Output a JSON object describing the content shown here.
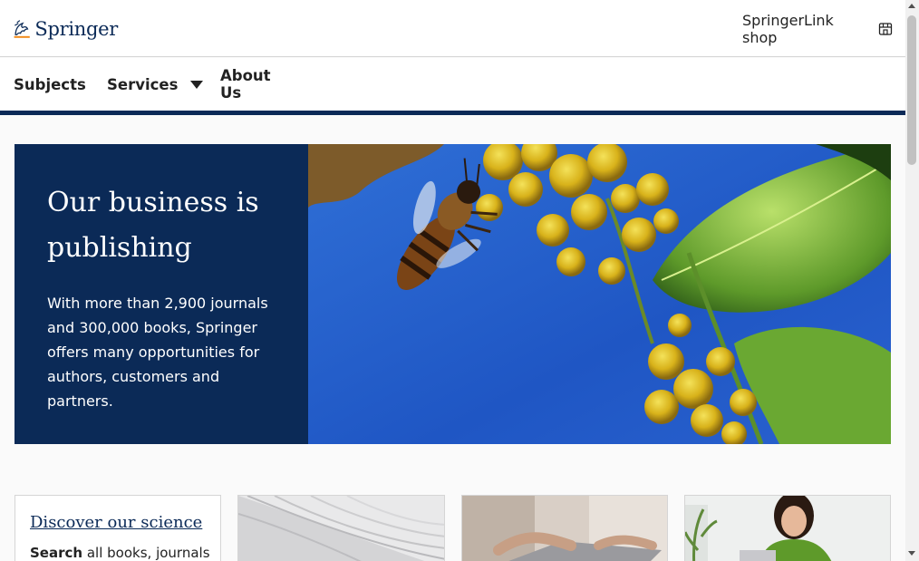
{
  "header": {
    "logo_text": "Springer",
    "shop_link": "SpringerLink shop",
    "shop_icon": "storefront-icon"
  },
  "nav": {
    "subjects": "Subjects",
    "services": "Services",
    "about": "About Us"
  },
  "hero": {
    "title_line1": "Our business is",
    "title_line2": "publishing",
    "body": "With more than 2,900 journals and 300,000 books, Springer offers many opportunities for authors, customers and partners.",
    "image_alt": "bee on yellow flowers"
  },
  "cards": {
    "discover_link": "Discover our science",
    "discover_text_bold": "Search",
    "discover_text_rest": "all books, journals"
  },
  "colors": {
    "brand_navy": "#0b2a57",
    "accent_orange": "#f28b1a"
  }
}
